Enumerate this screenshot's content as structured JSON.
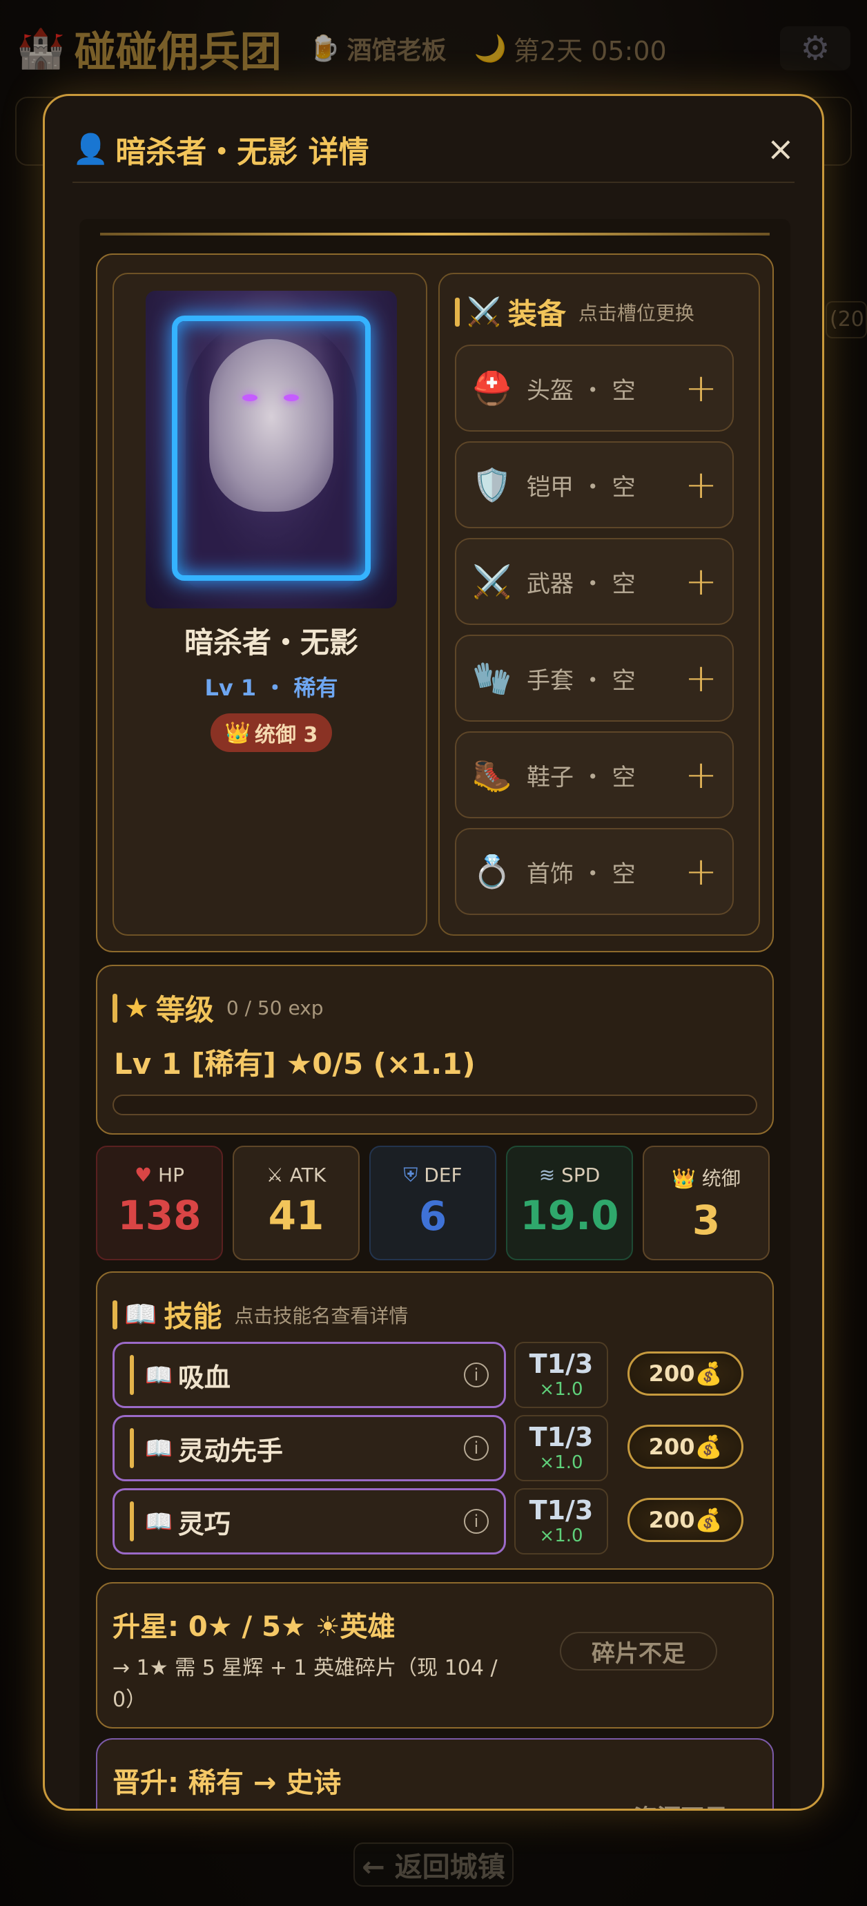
{
  "topbar": {
    "game_title": "碰碰佣兵团",
    "tavern_label": "酒馆老板",
    "day_time": "第2天 05:00",
    "side_tag": "(20"
  },
  "footer": {
    "back_label": "← 返回城镇"
  },
  "modal": {
    "title": "暗杀者・无影 详情",
    "close": "×"
  },
  "hero": {
    "name": "暗杀者・无影",
    "level_rarity": "Lv 1 ・ 稀有",
    "command_badge": "统御 3"
  },
  "equipment": {
    "title": "装备",
    "hint": "点击槽位更换",
    "slots": [
      {
        "label": "头盔 ・ 空",
        "icon": "helmet-icon"
      },
      {
        "label": "铠甲 ・ 空",
        "icon": "shield-icon"
      },
      {
        "label": "武器 ・ 空",
        "icon": "swords-icon"
      },
      {
        "label": "手套 ・ 空",
        "icon": "glove-icon"
      },
      {
        "label": "鞋子 ・ 空",
        "icon": "boot-icon"
      },
      {
        "label": "首饰 ・ 空",
        "icon": "ring-icon"
      }
    ]
  },
  "level": {
    "title": "等级",
    "exp": "0 / 50 exp",
    "line": "Lv 1 [稀有] ★0/5 (×1.1)",
    "progress": 0
  },
  "stats": [
    {
      "label": "HP",
      "value": "138",
      "color": "#d94545"
    },
    {
      "label": "ATK",
      "value": "41",
      "color": "#f2c45a"
    },
    {
      "label": "DEF",
      "value": "6",
      "color": "#3f72d6"
    },
    {
      "label": "SPD",
      "value": "19.0",
      "color": "#2fa86c"
    },
    {
      "label": "统御",
      "value": "3",
      "color": "#f2c45a"
    }
  ],
  "skills": {
    "title": "技能",
    "hint": "点击技能名查看详情",
    "items": [
      {
        "name": "吸血",
        "tier": "T1/3",
        "mult": "×1.0",
        "cost": "200"
      },
      {
        "name": "灵动先手",
        "tier": "T1/3",
        "mult": "×1.0",
        "cost": "200"
      },
      {
        "name": "灵巧",
        "tier": "T1/3",
        "mult": "×1.0",
        "cost": "200"
      }
    ]
  },
  "upgrade_star": {
    "title": "升星: 0★ / 5★ ☀英雄",
    "desc": "→ 1★ 需 5 星辉 + 1 英雄碎片（现 104 / 0）",
    "button": "碎片不足"
  },
  "promote": {
    "title": "晋升: 稀有 → 史诗",
    "button": "资源不足"
  }
}
